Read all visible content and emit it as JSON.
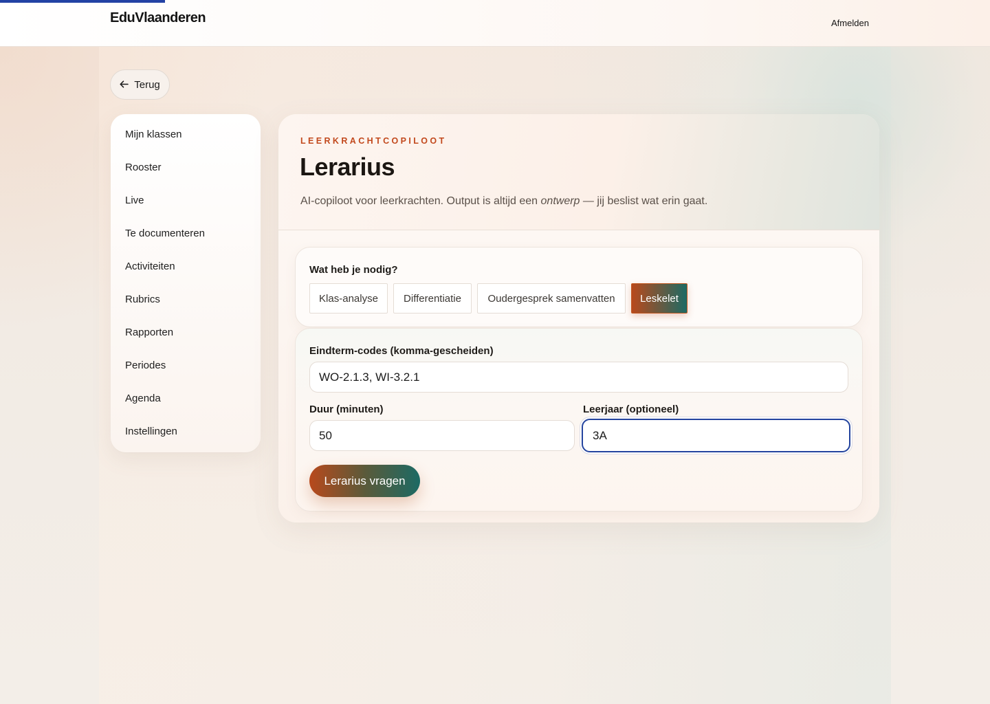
{
  "header": {
    "brand": "EduVlaanderen",
    "logout_label": "Afmelden"
  },
  "back_button": {
    "icon": "arrow-left-icon",
    "label": "Terug"
  },
  "sidebar": {
    "items": [
      {
        "label": "Mijn klassen"
      },
      {
        "label": "Rooster"
      },
      {
        "label": "Live"
      },
      {
        "label": "Te documenteren"
      },
      {
        "label": "Activiteiten"
      },
      {
        "label": "Rubrics"
      },
      {
        "label": "Rapporten"
      },
      {
        "label": "Periodes"
      },
      {
        "label": "Agenda"
      },
      {
        "label": "Instellingen"
      }
    ]
  },
  "main": {
    "eyebrow": "LEERKRACHTCOPILOOT",
    "title": "Lerarius",
    "subtitle_pre": "AI-copiloot voor leerkrachten. Output is altijd een ",
    "subtitle_em": "ontwerp",
    "subtitle_post": " — jij beslist wat erin gaat.",
    "type_question": "Wat heb je nodig?",
    "types": [
      {
        "label": "Klas-analyse",
        "active": false
      },
      {
        "label": "Differentiatie",
        "active": false
      },
      {
        "label": "Oudergesprek samenvatten",
        "active": false
      },
      {
        "label": "Leskelet",
        "active": true
      }
    ],
    "form": {
      "codes_label": "Eindterm-codes (komma-gescheiden)",
      "codes_value": "WO-2.1.3, WI-3.2.1",
      "duration_label": "Duur (minuten)",
      "duration_value": "50",
      "grade_label": "Leerjaar (optioneel)",
      "grade_value": "3A",
      "submit_label": "Lerarius vragen"
    }
  },
  "colors": {
    "accent_orange": "#c2491d",
    "accent_teal": "#1d6a64",
    "focus_blue": "#24449e"
  }
}
